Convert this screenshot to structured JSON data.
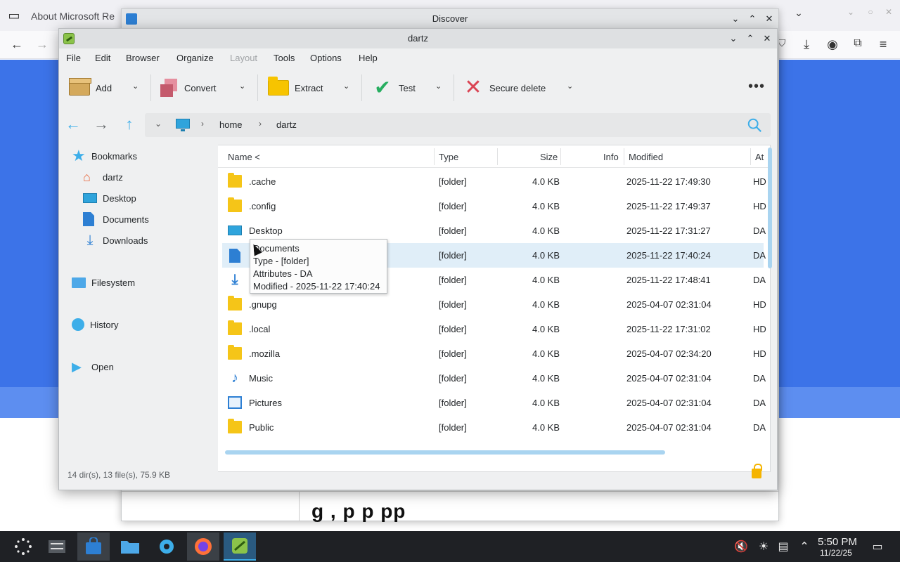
{
  "browser": {
    "tab_title": "About Microsoft Re",
    "icons": [
      "tab-list-icon",
      "back-icon",
      "forward-icon",
      "download-icon",
      "account-icon",
      "extensions-icon",
      "menu-icon"
    ]
  },
  "discover": {
    "title": "Discover",
    "bottom_text": "g , p                        p      pp"
  },
  "ark": {
    "title": "dartz",
    "menu": [
      "File",
      "Edit",
      "Browser",
      "Organize",
      "Layout",
      "Tools",
      "Options",
      "Help"
    ],
    "toolbar": {
      "add": "Add",
      "convert": "Convert",
      "extract": "Extract",
      "test": "Test",
      "secure_delete": "Secure delete",
      "more": "•••"
    },
    "breadcrumb": {
      "home": "home",
      "dartz": "dartz"
    },
    "places": {
      "bookmarks": "Bookmarks",
      "dartz": "dartz",
      "desktop": "Desktop",
      "documents": "Documents",
      "downloads": "Downloads",
      "filesystem": "Filesystem",
      "history": "History",
      "open": "Open"
    },
    "columns": {
      "name": "Name <",
      "type": "Type",
      "size": "Size",
      "info": "Info",
      "modified": "Modified",
      "attr": "At"
    },
    "rows": [
      {
        "name": ".cache",
        "type": "[folder]",
        "size": "4.0 KB",
        "modified": "2025-11-22 17:49:30",
        "attr": "HD",
        "icon": "folder-icon"
      },
      {
        "name": ".config",
        "type": "[folder]",
        "size": "4.0 KB",
        "modified": "2025-11-22 17:49:37",
        "attr": "HD",
        "icon": "folder-icon"
      },
      {
        "name": "Desktop",
        "type": "[folder]",
        "size": "4.0 KB",
        "modified": "2025-11-22 17:31:27",
        "attr": "DA",
        "icon": "desktop-folder-icon"
      },
      {
        "name": "",
        "type": "[folder]",
        "size": "4.0 KB",
        "modified": "2025-11-22 17:40:24",
        "attr": "DA",
        "icon": "documents-folder-icon"
      },
      {
        "name": "",
        "type": "[folder]",
        "size": "4.0 KB",
        "modified": "2025-11-22 17:48:41",
        "attr": "DA",
        "icon": "downloads-folder-icon"
      },
      {
        "name": ".gnupg",
        "type": "[folder]",
        "size": "4.0 KB",
        "modified": "2025-04-07 02:31:04",
        "attr": "HD",
        "icon": "folder-icon"
      },
      {
        "name": ".local",
        "type": "[folder]",
        "size": "4.0 KB",
        "modified": "2025-11-22 17:31:02",
        "attr": "HD",
        "icon": "folder-icon"
      },
      {
        "name": ".mozilla",
        "type": "[folder]",
        "size": "4.0 KB",
        "modified": "2025-04-07 02:34:20",
        "attr": "HD",
        "icon": "folder-icon"
      },
      {
        "name": "Music",
        "type": "[folder]",
        "size": "4.0 KB",
        "modified": "2025-04-07 02:31:04",
        "attr": "DA",
        "icon": "music-folder-icon"
      },
      {
        "name": "Pictures",
        "type": "[folder]",
        "size": "4.0 KB",
        "modified": "2025-04-07 02:31:04",
        "attr": "DA",
        "icon": "pictures-folder-icon"
      },
      {
        "name": "Public",
        "type": "[folder]",
        "size": "4.0 KB",
        "modified": "2025-04-07 02:31:04",
        "attr": "DA",
        "icon": "folder-icon"
      }
    ],
    "tooltip": {
      "name": "Documents",
      "type": "Type -  [folder]",
      "attributes": "Attributes - DA",
      "modified": "Modified - 2025-11-22 17:40:24"
    },
    "status": "14 dir(s), 13 file(s), 75.9 KB"
  },
  "taskbar": {
    "time": "5:50 PM",
    "date": "11/22/25"
  },
  "colors": {
    "accent": "#3daee9",
    "selection": "#e0eef8",
    "folder": "#f5c518",
    "taskbar": "#1f2125"
  }
}
